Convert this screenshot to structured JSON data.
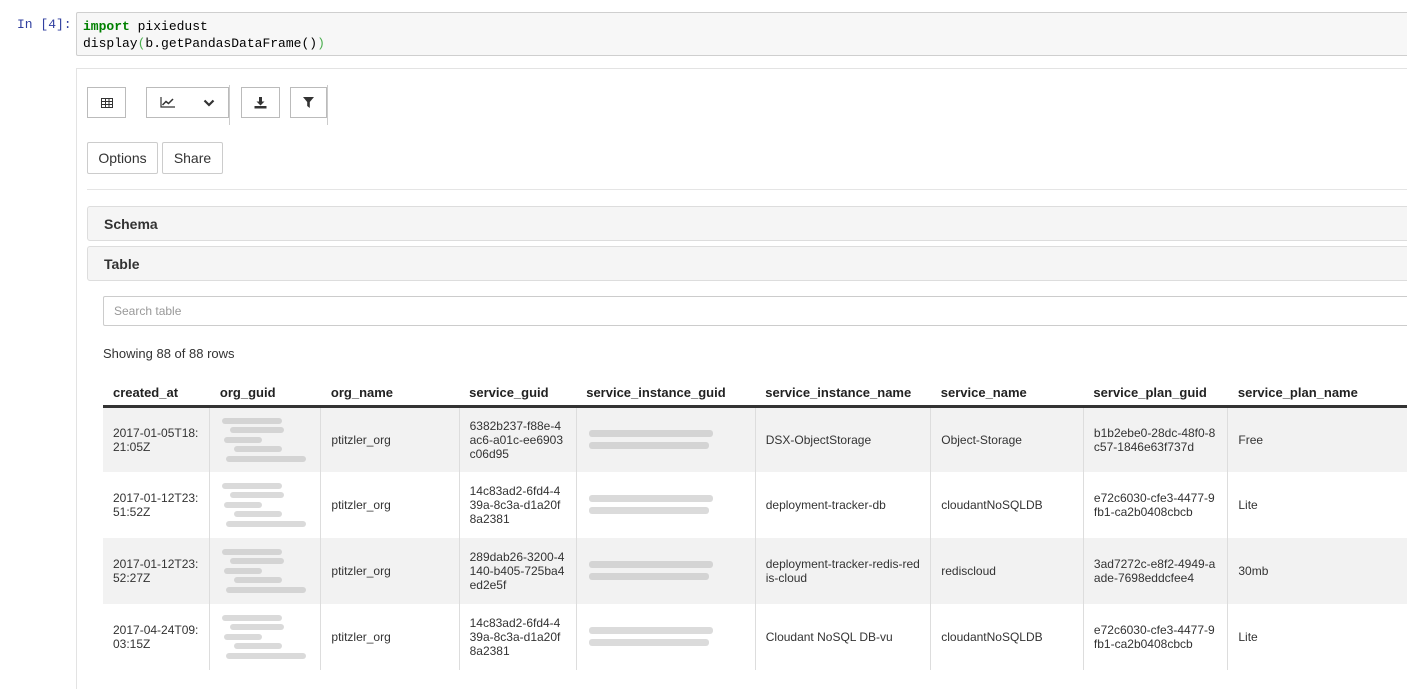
{
  "cell": {
    "prompt": "In [4]:",
    "line1_keyword": "import",
    "line1_rest": " pixiedust",
    "line2_func": "display",
    "line2_open": "(",
    "line2_arg": "b.getPandasDataFrame()",
    "line2_close": ")"
  },
  "toolbar": {
    "icons": [
      "table-icon",
      "line-chart-icon",
      "chevron-down-icon",
      "download-icon",
      "filter-icon"
    ],
    "options_label": "Options",
    "share_label": "Share"
  },
  "panels": {
    "schema_label": "Schema",
    "table_label": "Table"
  },
  "search": {
    "placeholder": "Search table",
    "value": ""
  },
  "row_count": "Showing 88 of 88 rows",
  "columns": [
    "created_at",
    "org_guid",
    "org_name",
    "service_guid",
    "service_instance_guid",
    "service_instance_name",
    "service_name",
    "service_plan_guid",
    "service_plan_name"
  ],
  "rows": [
    {
      "created_at": "2017-01-05T18:21:05Z",
      "org_name": "ptitzler_org",
      "service_guid": "6382b237-f88e-4ac6-a01c-ee6903c06d95",
      "service_instance_name": "DSX-ObjectStorage",
      "service_name": "Object-Storage",
      "service_plan_guid": "b1b2ebe0-28dc-48f0-8c57-1846e63f737d",
      "service_plan_name": "Free"
    },
    {
      "created_at": "2017-01-12T23:51:52Z",
      "org_name": "ptitzler_org",
      "service_guid": "14c83ad2-6fd4-439a-8c3a-d1a20f8a2381",
      "service_instance_name": "deployment-tracker-db",
      "service_name": "cloudantNoSQLDB",
      "service_plan_guid": "e72c6030-cfe3-4477-9fb1-ca2b0408cbcb",
      "service_plan_name": "Lite"
    },
    {
      "created_at": "2017-01-12T23:52:27Z",
      "org_name": "ptitzler_org",
      "service_guid": "289dab26-3200-4140-b405-725ba4ed2e5f",
      "service_instance_name": "deployment-tracker-redis-redis-cloud",
      "service_name": "rediscloud",
      "service_plan_guid": "3ad7272c-e8f2-4949-aade-7698eddcfee4",
      "service_plan_name": "30mb"
    },
    {
      "created_at": "2017-04-24T09:03:15Z",
      "org_name": "ptitzler_org",
      "service_guid": "14c83ad2-6fd4-439a-8c3a-d1a20f8a2381",
      "service_instance_name": "Cloudant NoSQL DB-vu",
      "service_name": "cloudantNoSQLDB",
      "service_plan_guid": "e72c6030-cfe3-4477-9fb1-ca2b0408cbcb",
      "service_plan_name": "Lite"
    }
  ]
}
